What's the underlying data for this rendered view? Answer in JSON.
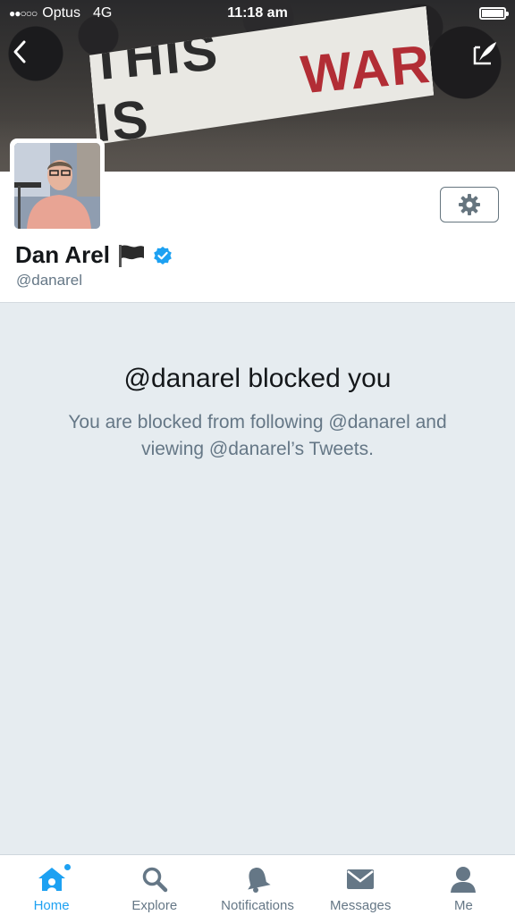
{
  "status_bar": {
    "carrier": "Optus",
    "network": "4G",
    "time": "11:18 am"
  },
  "banner": {
    "sign_word_1": "THIS IS",
    "sign_word_2": "WAR"
  },
  "profile": {
    "name": "Dan Arel",
    "handle": "@danarel",
    "verified": true
  },
  "blocked": {
    "title": "@danarel blocked you",
    "message": "You are blocked from following @danarel and viewing @danarel’s Tweets."
  },
  "tabs": [
    {
      "label": "Home",
      "icon": "home-icon",
      "active": true
    },
    {
      "label": "Explore",
      "icon": "search-icon",
      "active": false
    },
    {
      "label": "Notifications",
      "icon": "bell-icon",
      "active": false
    },
    {
      "label": "Messages",
      "icon": "envelope-icon",
      "active": false
    },
    {
      "label": "Me",
      "icon": "person-icon",
      "active": false
    }
  ],
  "colors": {
    "accent": "#1da1f2",
    "muted": "#657786",
    "background": "#e6ecf0"
  }
}
